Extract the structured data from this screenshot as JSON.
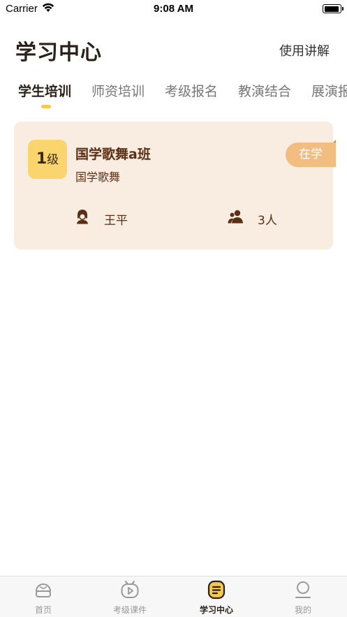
{
  "status_bar": {
    "carrier": "Carrier",
    "time": "9:08 AM"
  },
  "header": {
    "title": "学习中心",
    "guide_link": "使用讲解"
  },
  "tabs": [
    {
      "label": "学生培训",
      "active": true
    },
    {
      "label": "师资培训",
      "active": false
    },
    {
      "label": "考级报名",
      "active": false
    },
    {
      "label": "教演结合",
      "active": false
    },
    {
      "label": "展演报名",
      "active": false
    }
  ],
  "classes": [
    {
      "level_num": "1",
      "level_unit": "级",
      "name": "国学歌舞a班",
      "subject": "国学歌舞",
      "status": "在学",
      "teacher": "王平",
      "student_count": "3人"
    }
  ],
  "bottom_nav": [
    {
      "label": "首页",
      "icon": "home-icon",
      "active": false
    },
    {
      "label": "考级课件",
      "icon": "video-icon",
      "active": false
    },
    {
      "label": "学习中心",
      "icon": "study-icon",
      "active": true
    },
    {
      "label": "我的",
      "icon": "profile-icon",
      "active": false
    }
  ],
  "colors": {
    "accent": "#f6c84d",
    "card_bg": "#f8ede0",
    "status_pill": "#f2bd80",
    "text_brown": "#5b2f16"
  }
}
